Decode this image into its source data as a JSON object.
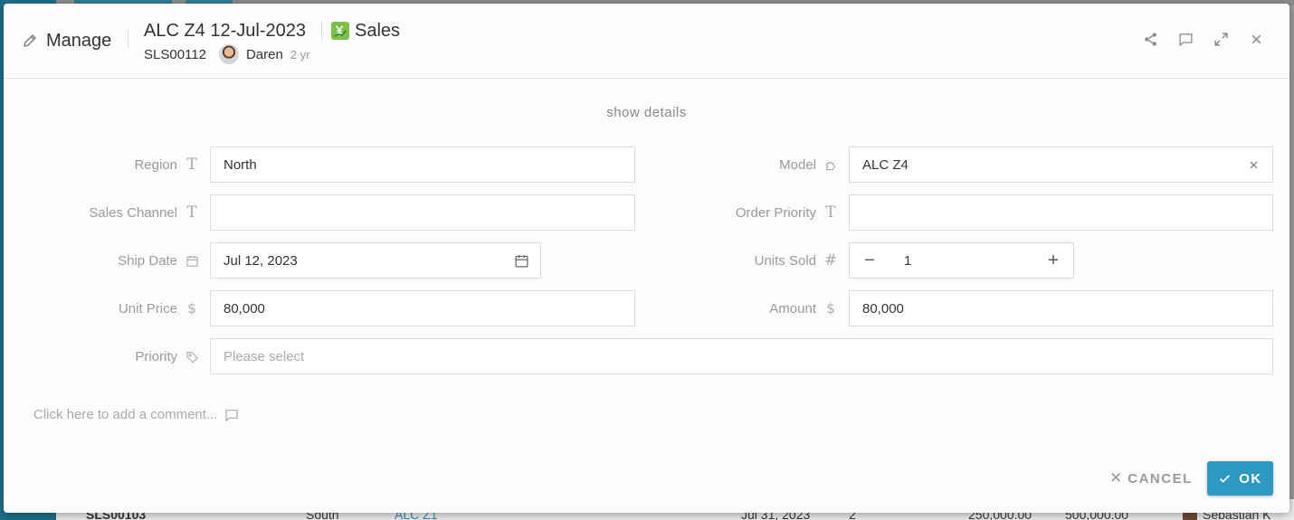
{
  "background": {
    "row": {
      "id": "SLS00103",
      "region": "South",
      "model": "ALC Z1",
      "ship_date": "Jul 31, 2023",
      "units": "2",
      "unit_price": "250,000.00",
      "amount": "500,000.00",
      "owner": "Sebastian K"
    }
  },
  "header": {
    "mode_label": "Manage",
    "record_title": "ALC Z4 12-Jul-2023",
    "app_name": "Sales",
    "app_icon": "yen-chart-icon",
    "record_id": "SLS00112",
    "owner_name": "Daren",
    "age": "2 yr",
    "tools": [
      "share-icon",
      "comment-icon",
      "expand-icon",
      "close-icon"
    ]
  },
  "show_details_label": "show details",
  "fields": {
    "region": {
      "label": "Region",
      "value": "North",
      "icon": "text-type-icon"
    },
    "model": {
      "label": "Model",
      "value": "ALC Z4",
      "icon": "puzzle-icon"
    },
    "sales_channel": {
      "label": "Sales Channel",
      "value": "",
      "icon": "text-type-icon"
    },
    "order_priority": {
      "label": "Order Priority",
      "value": "",
      "icon": "text-type-icon"
    },
    "ship_date": {
      "label": "Ship Date",
      "value": "Jul 12, 2023",
      "icon": "calendar-icon"
    },
    "units_sold": {
      "label": "Units Sold",
      "value": "1",
      "icon": "hash-icon"
    },
    "unit_price": {
      "label": "Unit Price",
      "value": "80,000",
      "icon": "dollar-icon"
    },
    "amount": {
      "label": "Amount",
      "value": "80,000",
      "icon": "dollar-icon"
    },
    "priority": {
      "label": "Priority",
      "value": "",
      "placeholder": "Please select",
      "icon": "tag-icon"
    }
  },
  "comment_placeholder": "Click here to add a comment...",
  "actions": {
    "cancel_label": "CANCEL",
    "ok_label": "OK"
  },
  "colors": {
    "primary": "#2e9ac4",
    "app_badge": "#7cc144"
  }
}
